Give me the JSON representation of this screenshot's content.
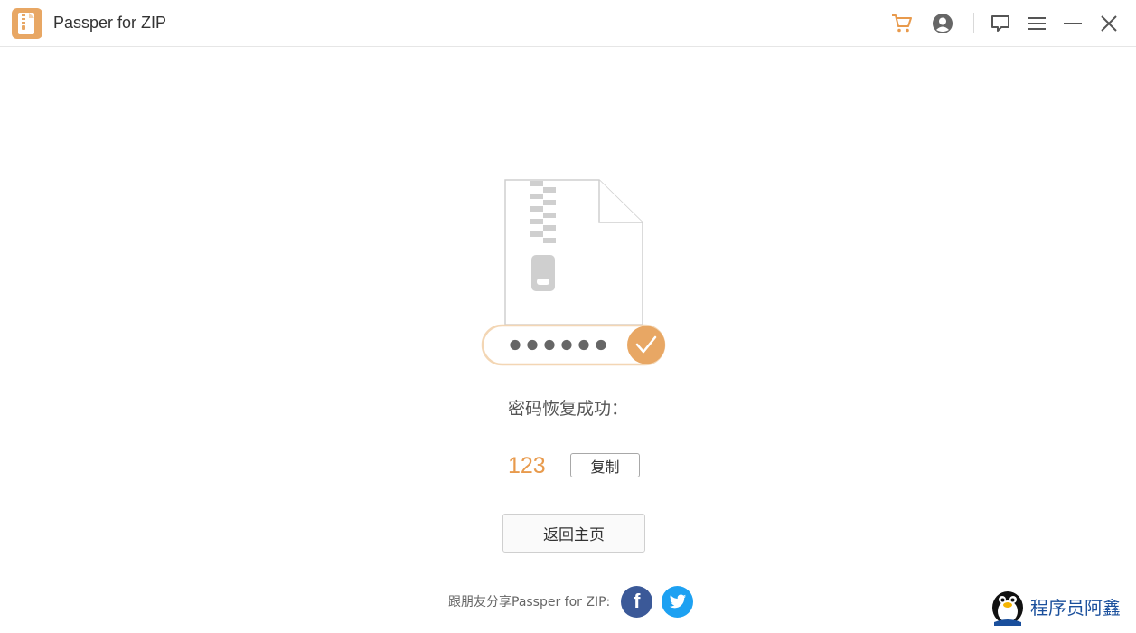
{
  "app": {
    "title": "Passper for ZIP"
  },
  "toolbar": {
    "icons": [
      "cart-icon",
      "user-icon",
      "feedback-icon",
      "menu-icon",
      "minimize-icon",
      "close-icon"
    ],
    "accent_color": "#e89a4c"
  },
  "illustration": {
    "masked_password": "●●●●●●"
  },
  "result": {
    "success_label": "密码恢复成功：",
    "password": "123",
    "copy_label": "复制"
  },
  "actions": {
    "home_label": "返回主页"
  },
  "share": {
    "label": "跟朋友分享Passper for ZIP:",
    "facebook": "f"
  },
  "watermark": {
    "text": "程序员阿鑫"
  }
}
